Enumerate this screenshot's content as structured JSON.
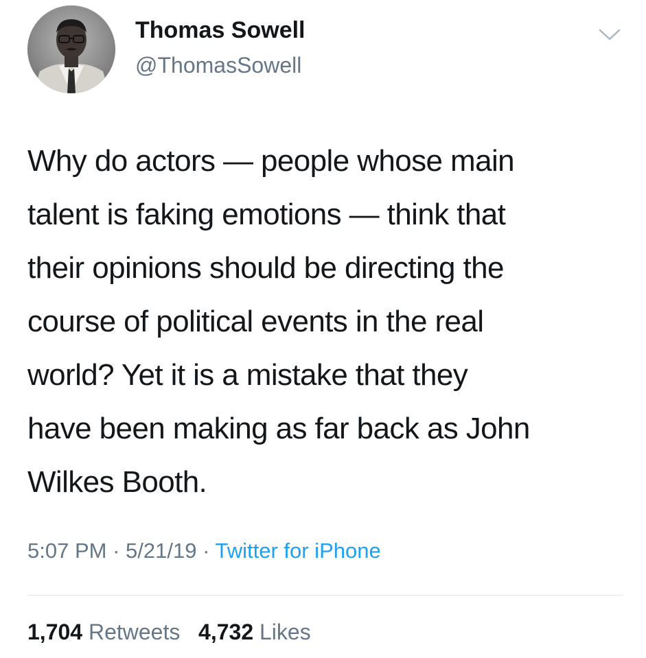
{
  "author": {
    "display_name": "Thomas Sowell",
    "handle": "@ThomasSowell",
    "avatar_icon": "profile-photo"
  },
  "menu_icon": "chevron-down-icon",
  "tweet": {
    "lines": [
      "Why do actors — people whose main",
      "talent is faking emotions — think that",
      "their opinions should be directing the",
      "course of political events in the real",
      "world? Yet it is a mistake that they",
      "have been making as far back as John",
      "Wilkes Booth."
    ]
  },
  "meta": {
    "time": "5:07 PM",
    "date": "5/21/19",
    "separator": "·",
    "source": "Twitter for iPhone"
  },
  "stats": {
    "retweets_count": "1,704",
    "retweets_label": "Retweets",
    "likes_count": "4,732",
    "likes_label": "Likes"
  },
  "colors": {
    "text": "#14171a",
    "secondary": "#657786",
    "link": "#1da1f2",
    "divider": "#e1e8ed"
  }
}
